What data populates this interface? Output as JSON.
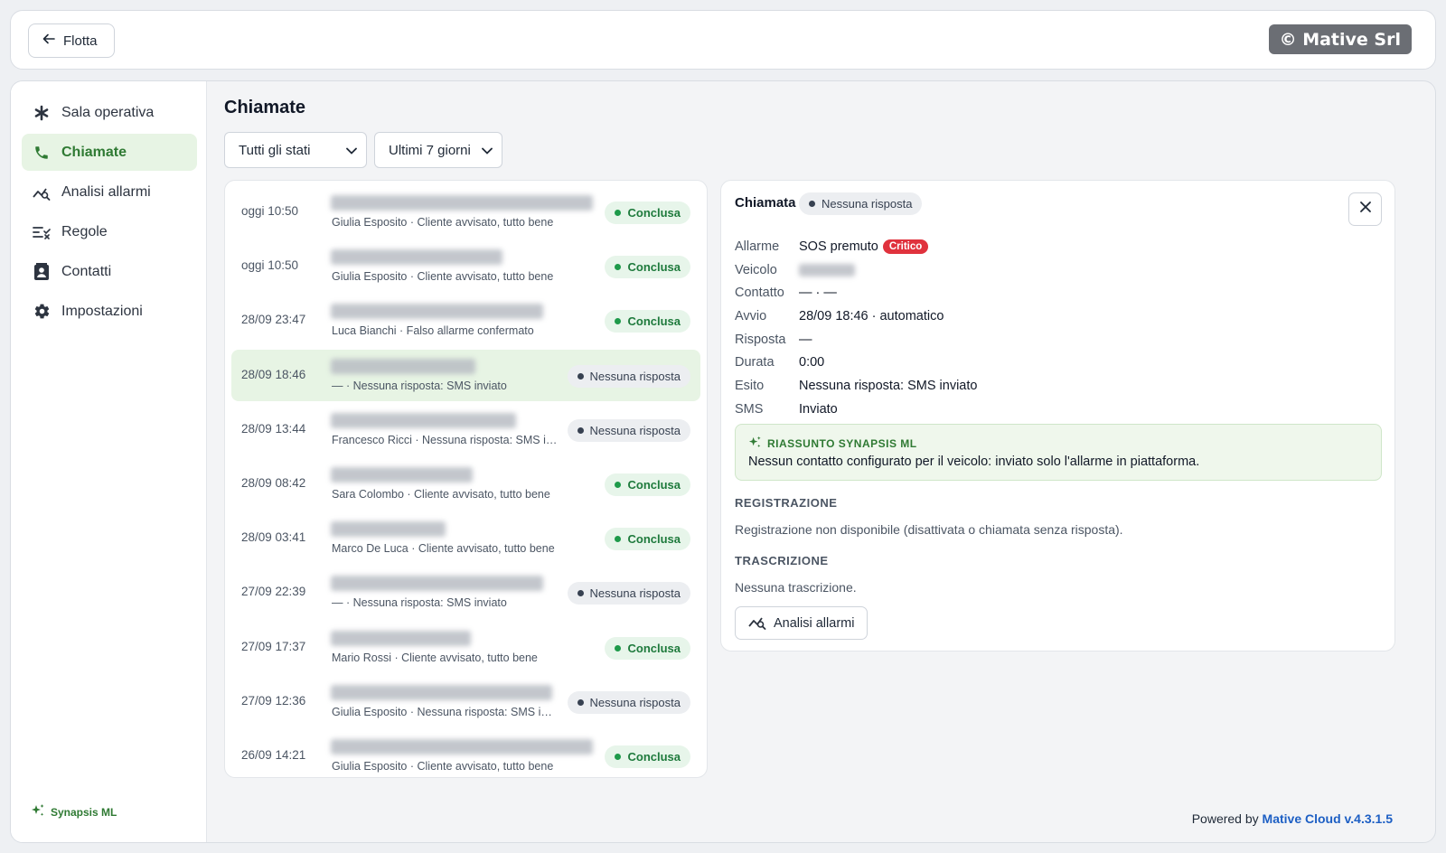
{
  "header": {
    "back_label": "Flotta",
    "brand": "© Mative Srl"
  },
  "sidebar": {
    "items": [
      {
        "label": "Sala operativa",
        "icon": "asterisk-icon"
      },
      {
        "label": "Chiamate",
        "icon": "phone-icon",
        "active": true
      },
      {
        "label": "Analisi allarmi",
        "icon": "chart-search-icon"
      },
      {
        "label": "Regole",
        "icon": "rules-icon"
      },
      {
        "label": "Contatti",
        "icon": "contact-card-icon"
      },
      {
        "label": "Impostazioni",
        "icon": "gear-icon"
      }
    ],
    "footer": "Synapsis ML"
  },
  "page": {
    "title": "Chiamate",
    "filter_status": "Tutti gli stati",
    "filter_period": "Ultimi 7 giorni"
  },
  "calls": [
    {
      "time": "oggi 10:50",
      "sub": "Giulia Esposito · Cliente avvisato, tutto bene",
      "status": "Conclusa",
      "kind": "ok"
    },
    {
      "time": "oggi 10:50",
      "sub": "Giulia Esposito · Cliente avvisato, tutto bene",
      "status": "Conclusa",
      "kind": "ok"
    },
    {
      "time": "28/09 23:47",
      "sub": "Luca Bianchi · Falso allarme confermato",
      "status": "Conclusa",
      "kind": "ok"
    },
    {
      "time": "28/09 18:46",
      "sub": "— · Nessuna risposta: SMS inviato",
      "status": "Nessuna risposta",
      "kind": "no",
      "selected": true
    },
    {
      "time": "28/09 13:44",
      "sub": "Francesco Ricci · Nessuna risposta: SMS inviato",
      "status": "Nessuna risposta",
      "kind": "no"
    },
    {
      "time": "28/09 08:42",
      "sub": "Sara Colombo · Cliente avvisato, tutto bene",
      "status": "Conclusa",
      "kind": "ok"
    },
    {
      "time": "28/09 03:41",
      "sub": "Marco De Luca · Cliente avvisato, tutto bene",
      "status": "Conclusa",
      "kind": "ok"
    },
    {
      "time": "27/09 22:39",
      "sub": "— · Nessuna risposta: SMS inviato",
      "status": "Nessuna risposta",
      "kind": "no"
    },
    {
      "time": "27/09 17:37",
      "sub": "Mario Rossi · Cliente avvisato, tutto bene",
      "status": "Conclusa",
      "kind": "ok"
    },
    {
      "time": "27/09 12:36",
      "sub": "Giulia Esposito · Nessuna risposta: SMS inviato",
      "status": "Nessuna risposta",
      "kind": "no"
    },
    {
      "time": "26/09 14:21",
      "sub": "Giulia Esposito · Cliente avvisato, tutto bene",
      "status": "Conclusa",
      "kind": "ok"
    }
  ],
  "detail": {
    "title": "Chiamata",
    "status": "Nessuna risposta",
    "fields": [
      {
        "label": "Allarme",
        "value": "SOS premuto",
        "badge": "Critico"
      },
      {
        "label": "Veicolo",
        "value": "",
        "blurred": true
      },
      {
        "label": "Contatto",
        "value": "— · —"
      },
      {
        "label": "Avvio",
        "value": "28/09 18:46 · automatico"
      },
      {
        "label": "Risposta",
        "value": "—"
      },
      {
        "label": "Durata",
        "value": "0:00"
      },
      {
        "label": "Esito",
        "value": "Nessuna risposta: SMS inviato"
      },
      {
        "label": "SMS",
        "value": "Inviato"
      }
    ],
    "summary_head": "RIASSUNTO SYNAPSIS ML",
    "summary_text": "Nessun contatto configurato per il veicolo: inviato solo l'allarme in piattaforma.",
    "rec_head": "REGISTRAZIONE",
    "rec_text": "Registrazione non disponibile (disattivata o chiamata senza risposta).",
    "tr_head": "TRASCRIZIONE",
    "tr_text": "Nessuna trascrizione.",
    "analisi_label": "Analisi allarmi"
  },
  "footer": {
    "prefix": "Powered by",
    "product": "Mative Cloud v.4.3.1.5"
  },
  "colors": {
    "accent_green": "#2f7a33",
    "active_bg": "#e7f4e4",
    "critical": "#e0323d",
    "link_blue": "#1d5fc4"
  }
}
